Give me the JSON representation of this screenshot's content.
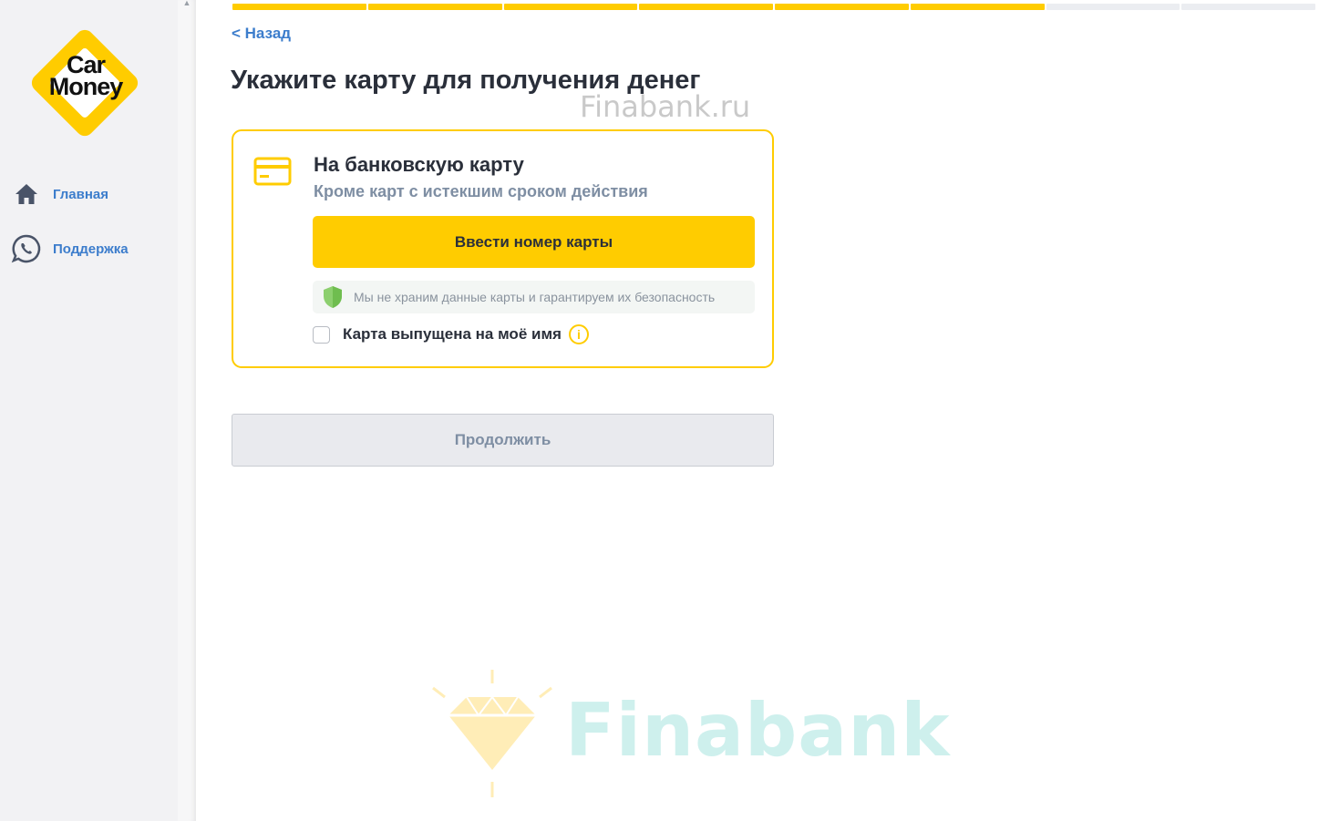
{
  "sidebar": {
    "logo_line1": "Car",
    "logo_line2": "Money",
    "items": [
      {
        "label": "Главная",
        "icon": "home-icon"
      },
      {
        "label": "Поддержка",
        "icon": "whatsapp-icon"
      }
    ]
  },
  "progress": {
    "total_steps": 8,
    "completed_steps": 6,
    "color_done": "#ffcc00",
    "color_todo": "#ebedf1"
  },
  "header": {
    "back_label": "< Назад",
    "title": "Укажите карту для получения денег"
  },
  "watermarks": {
    "top": "Finabank.ru",
    "bottom": "Finabank"
  },
  "card_option": {
    "icon": "credit-card-icon",
    "title": "На банковскую карту",
    "subtitle": "Кроме карт с истекшим сроком действия",
    "enter_button_label": "Ввести номер карты",
    "security_note": "Мы не храним данные карты и гарантируем их безопасность",
    "owner_checkbox_label": "Карта выпущена на моё имя",
    "owner_checkbox_checked": false,
    "info_icon": "info-icon"
  },
  "footer": {
    "continue_label": "Продолжить"
  },
  "colors": {
    "accent": "#ffcc00",
    "link": "#3c7dcc",
    "shield": "#8ccf6e"
  }
}
